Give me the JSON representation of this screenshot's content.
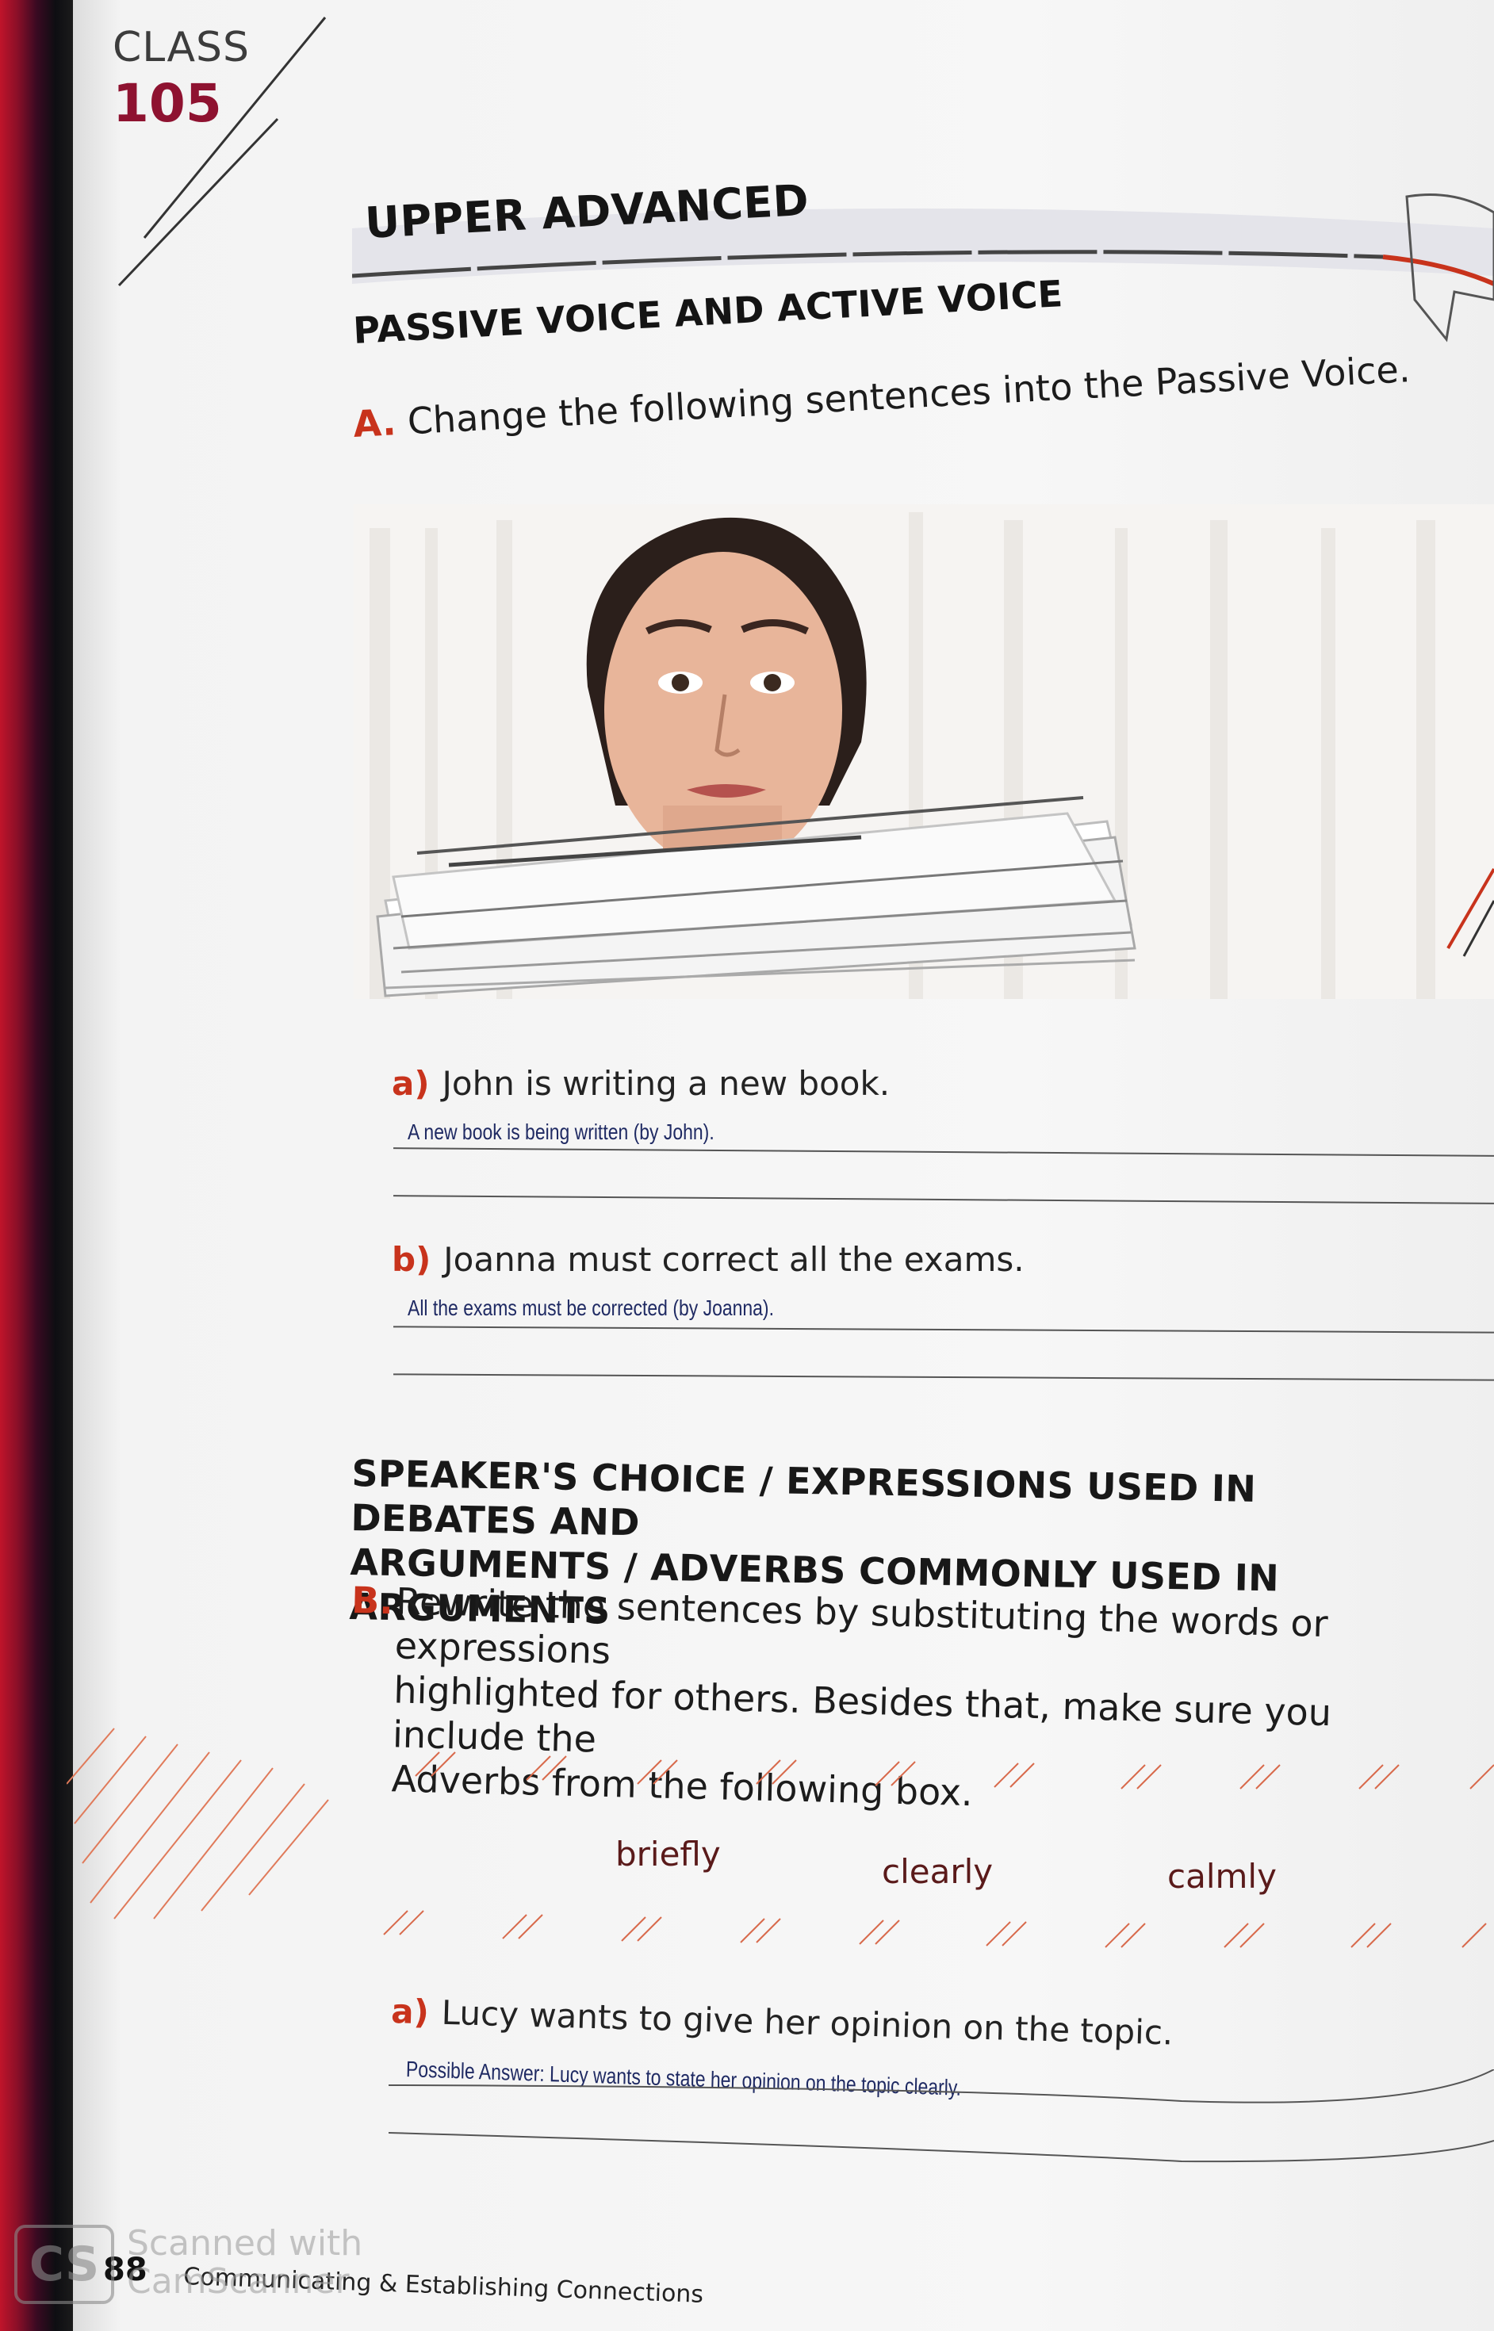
{
  "header": {
    "class_label": "CLASS",
    "class_number": "105",
    "level": "UPPER ADVANCED"
  },
  "section1": {
    "title": "PASSIVE VOICE AND ACTIVE VOICE",
    "exercise_letter": "A.",
    "exercise_text": "Change the following sentences into the Passive Voice.",
    "items": [
      {
        "label": "a)",
        "sentence": "John is writing a new book.",
        "answer": "A new book is being written (by John)."
      },
      {
        "label": "b)",
        "sentence": "Joanna must correct all the exams.",
        "answer": "All the exams must be corrected (by Joanna)."
      }
    ]
  },
  "section2": {
    "title_line1": "SPEAKER'S CHOICE / EXPRESSIONS USED IN DEBATES AND",
    "title_line2": "ARGUMENTS / ADVERBS COMMONLY USED IN ARGUMENTS",
    "exercise_letter": "B.",
    "exercise_line1": "Rewrite the sentences by substituting the words or expressions",
    "exercise_line2": "highlighted for others. Besides that, make sure you include the",
    "exercise_line3": "Adverbs from the following box.",
    "adverbs": [
      "briefly",
      "clearly",
      "calmly"
    ],
    "items": [
      {
        "label": "a)",
        "sentence": "Lucy wants to give her opinion on the topic.",
        "answer": "Possible Answer: Lucy wants to state her opinion on the topic clearly."
      }
    ]
  },
  "footer": {
    "page_number": "88",
    "chapter": "Communicating & Establishing Connections"
  },
  "watermark": {
    "logo": "CS",
    "line1": "Scanned with",
    "line2": "CamScanner"
  },
  "colors": {
    "accent_red": "#c8331c",
    "class_number": "#8e1230",
    "answer_ink": "#1f2a63"
  }
}
